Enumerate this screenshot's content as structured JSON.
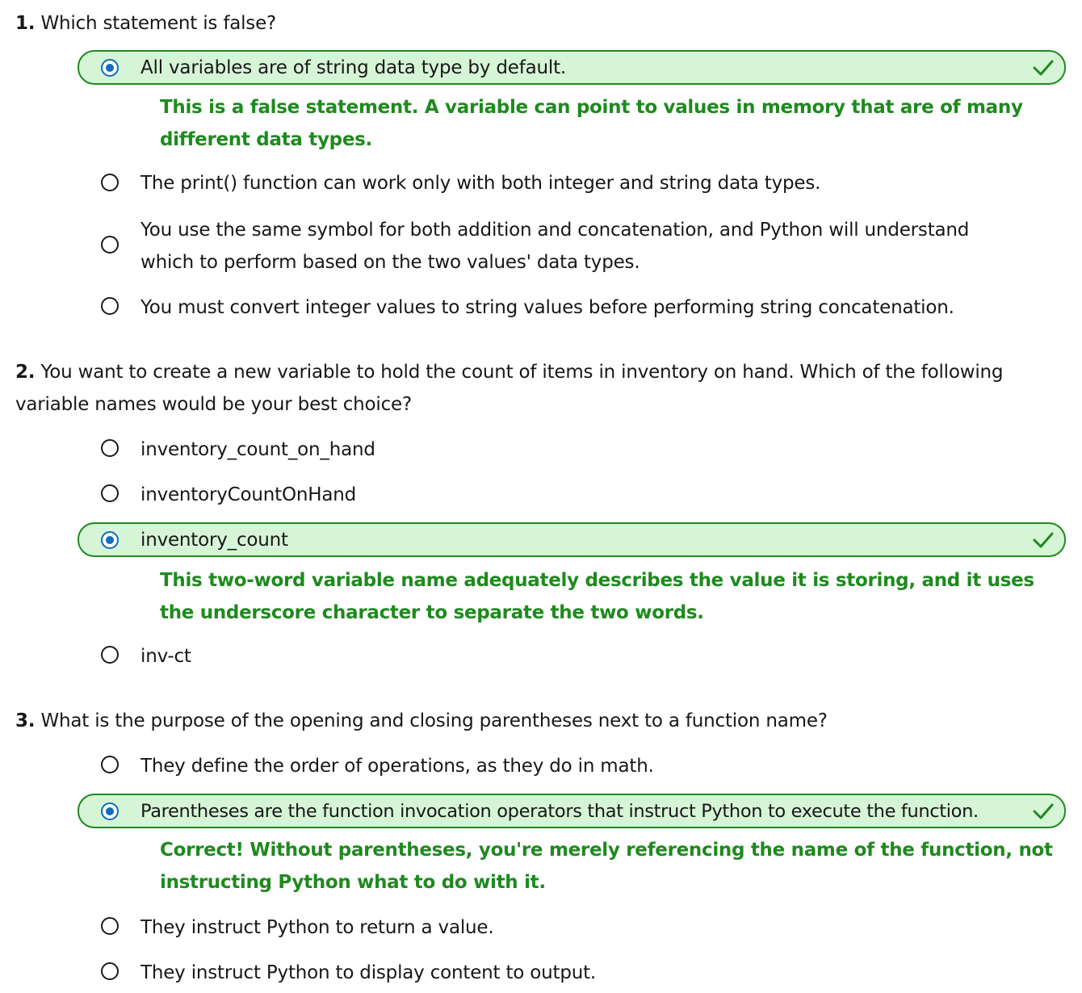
{
  "questions": [
    {
      "number": "1.",
      "text": "Which statement is false?",
      "options": [
        {
          "label": "All variables are of string data type by default.",
          "selected": true,
          "correct": true
        },
        {
          "label": "The print() function can work only with both integer and string data types.",
          "selected": false
        },
        {
          "label": "You use the same symbol for both addition and concatenation, and Python will understand which to perform based on the two values' data types.",
          "selected": false
        },
        {
          "label": "You must convert integer values to string values before performing string concatenation.",
          "selected": false
        }
      ],
      "feedback": "This is a false statement. A variable can point to values in memory that are of many different data types."
    },
    {
      "number": "2.",
      "text": "You want to create a new variable to hold the count of items in inventory on hand. Which of the following variable names would be your best choice?",
      "options": [
        {
          "label": "inventory_count_on_hand",
          "selected": false
        },
        {
          "label": "inventoryCountOnHand",
          "selected": false
        },
        {
          "label": "inventory_count",
          "selected": true,
          "correct": true
        },
        {
          "label": "inv-ct",
          "selected": false
        }
      ],
      "feedback": "This two-word variable name adequately describes the value it is storing, and it uses the underscore character to separate the two words."
    },
    {
      "number": "3.",
      "text": "What is the purpose of the opening and closing parentheses next to a function name?",
      "options": [
        {
          "label": "They define the order of operations, as they do in math.",
          "selected": false
        },
        {
          "label": "Parentheses are the function invocation operators that instruct Python to execute the function.",
          "selected": true,
          "correct": true
        },
        {
          "label": "They instruct Python to return a value.",
          "selected": false
        },
        {
          "label": "They instruct Python to display content to output.",
          "selected": false
        }
      ],
      "feedback": "Correct! Without parentheses, you're merely referencing the name of the function, not instructing Python what to do with it."
    }
  ],
  "icons": {
    "radio": "radio-button-icon",
    "check": "checkmark-icon"
  },
  "colors": {
    "correct_green": "#1e8a1e",
    "selected_bg": "#d6f5d6",
    "radio_blue": "#0f6cbd",
    "text": "#171717"
  }
}
